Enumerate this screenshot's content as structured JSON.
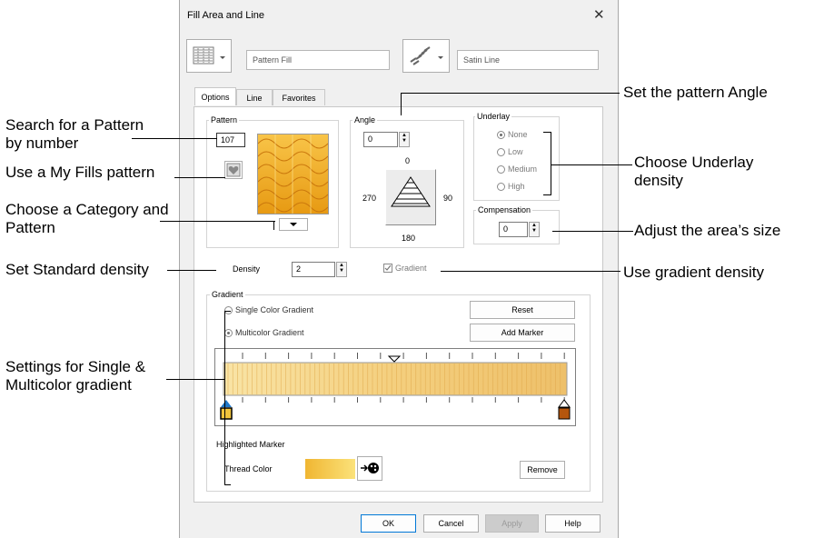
{
  "dialog": {
    "title": "Fill Area and Line",
    "fill_type": "Pattern Fill",
    "line_type": "Satin Line"
  },
  "tabs": [
    "Options",
    "Line",
    "Favorites"
  ],
  "pattern": {
    "label": "Pattern",
    "number": "107"
  },
  "angle": {
    "label": "Angle",
    "value": "0",
    "dial": {
      "top": "0",
      "left": "270",
      "right": "90",
      "bottom": "180"
    }
  },
  "underlay": {
    "label": "Underlay",
    "options": [
      "None",
      "Low",
      "Medium",
      "High"
    ],
    "selected": "None"
  },
  "compensation": {
    "label": "Compensation",
    "value": "0"
  },
  "density": {
    "label": "Density",
    "value": "2"
  },
  "gradient_check": {
    "label": "Gradient",
    "checked": true
  },
  "gradient": {
    "label": "Gradient",
    "single_label": "Single Color Gradient",
    "multi_label": "Multicolor Gradient",
    "selected": "Multicolor Gradient",
    "reset_label": "Reset",
    "add_marker_label": "Add Marker",
    "highlighted_marker_label": "Highlighted Marker",
    "thread_color_label": "Thread Color",
    "remove_label": "Remove",
    "colors": {
      "start": "#f7e08a",
      "end": "#b5560e",
      "marker_left": "#f0c33c",
      "accent": "#1f78c8"
    }
  },
  "footer": {
    "ok": "OK",
    "cancel": "Cancel",
    "apply": "Apply",
    "help": "Help"
  },
  "annotations": {
    "search_pattern": "Search for a Pattern by number",
    "my_fills": "Use a My Fills pattern",
    "category": "Choose a Category and Pattern",
    "standard_density": "Set Standard density",
    "gradient_settings": "Settings for Single & Multicolor gradient",
    "pattern_angle": "Set the pattern Angle",
    "underlay_density": "Choose Underlay density",
    "area_size": "Adjust the area’s size",
    "gradient_density": "Use gradient density"
  }
}
